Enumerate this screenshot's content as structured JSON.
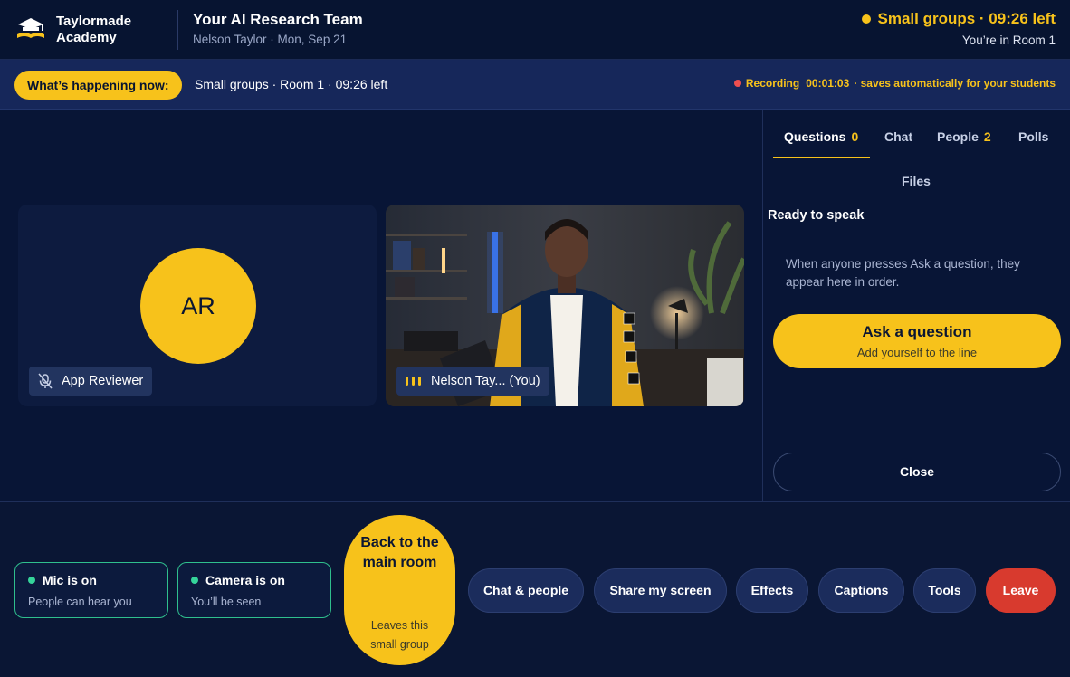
{
  "header": {
    "brand_name": "Taylormade Academy",
    "meeting_title": "Your AI Research Team",
    "meeting_subtitle": "Nelson Taylor · Mon, Sep 21",
    "status": "Small groups · 09:26 left",
    "room_note": "You’re in Room 1"
  },
  "infobar": {
    "happening_label": "What’s happening now:",
    "happening_text": "Small groups · Room 1 · 09:26 left",
    "recording_label": "Recording",
    "recording_time": "00:01:03",
    "recording_note": "· saves automatically for your students"
  },
  "stage": {
    "tiles": [
      {
        "initials": "AR",
        "name": "App Reviewer",
        "mic": "muted"
      },
      {
        "name": "Nelson Tay... (You)",
        "mic": "speaking",
        "video": true
      }
    ]
  },
  "panel": {
    "tabs": [
      {
        "label": "Questions",
        "count": "0",
        "active": true
      },
      {
        "label": "Chat"
      },
      {
        "label": "People",
        "count": "2"
      },
      {
        "label": "Polls"
      },
      {
        "label": "Files"
      }
    ],
    "section_title": "Ready to speak",
    "empty_note": "When anyone presses Ask a question, they appear here in order.",
    "ask_button": {
      "title": "Ask a question",
      "subtitle": "Add yourself to the line"
    },
    "close_label": "Close"
  },
  "bottombar": {
    "mic": {
      "title": "Mic is on",
      "subtitle": "People can hear you"
    },
    "camera": {
      "title": "Camera is on",
      "subtitle": "You’ll be seen"
    },
    "back": {
      "title": "Back to the main room",
      "subtitle": "Leaves this small group"
    },
    "buttons": {
      "chat_people": "Chat & people",
      "share_screen": "Share my screen",
      "effects": "Effects",
      "captions": "Captions",
      "tools": "Tools",
      "leave": "Leave"
    }
  },
  "colors": {
    "accent": "#f7c21b",
    "background": "#081536",
    "leave": "#d83a2e",
    "status_on": "#35d49a",
    "recording": "#ef4f4f"
  }
}
